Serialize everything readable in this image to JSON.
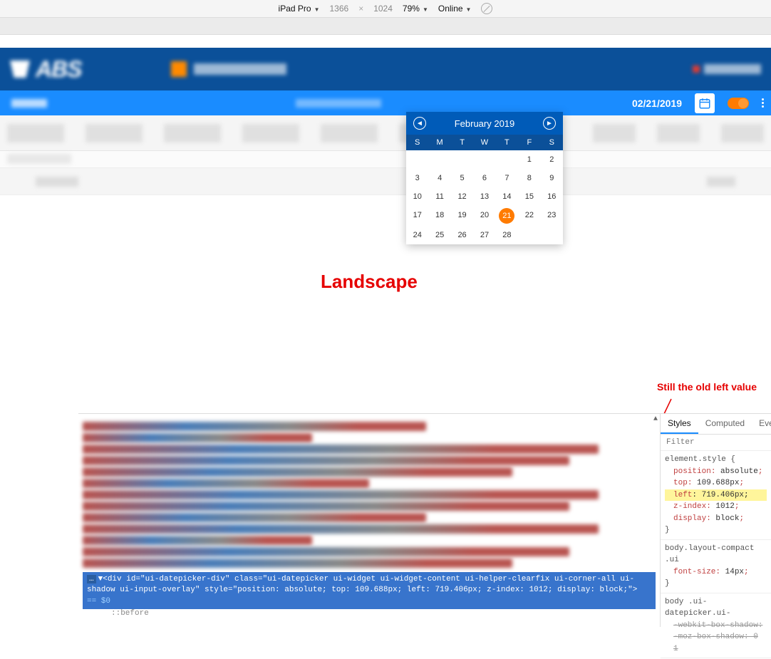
{
  "device_toolbar": {
    "device": "iPad Pro",
    "width": "1366",
    "height": "1024",
    "zoom": "79%",
    "network": "Online"
  },
  "app": {
    "logo_text": "ABS"
  },
  "subheader": {
    "date": "02/21/2019"
  },
  "datepicker": {
    "title": "February 2019",
    "dayheads": [
      "S",
      "M",
      "T",
      "W",
      "T",
      "F",
      "S"
    ],
    "weeks": [
      [
        "",
        "",
        "",
        "",
        "",
        "1",
        "2"
      ],
      [
        "3",
        "4",
        "5",
        "6",
        "7",
        "8",
        "9"
      ],
      [
        "10",
        "11",
        "12",
        "13",
        "14",
        "15",
        "16"
      ],
      [
        "17",
        "18",
        "19",
        "20",
        "21",
        "22",
        "23"
      ],
      [
        "24",
        "25",
        "26",
        "27",
        "28",
        "",
        ""
      ]
    ],
    "selected": "21"
  },
  "labels": {
    "landscape": "Landscape",
    "annotation": "Still the old left value"
  },
  "devtools": {
    "tabs": {
      "styles": "Styles",
      "computed": "Computed",
      "event": "Eve"
    },
    "filter_placeholder": "Filter",
    "selected_html": "<div id=\"ui-datepicker-div\" class=\"ui-datepicker ui-widget ui-widget-content ui-helper-clearfix ui-corner-all ui-shadow ui-input-overlay\" style=\"position: absolute; top: 109.688px; left: 719.406px; z-index: 1012; display: block;\">",
    "eq_suffix": "== $0",
    "before": "::before",
    "css1_sel": "element.style {",
    "css1_p1": "position",
    "css1_v1": "absolute",
    "css1_p2": "top",
    "css1_v2": "109.688px",
    "css1_p3": "left",
    "css1_v3": "719.406px",
    "css1_p4": "z-index",
    "css1_v4": "1012",
    "css1_p5": "display",
    "css1_v5": "block",
    "css_close": "}",
    "css2_sel": "body.layout-compact .ui",
    "css2_p1": "font-size",
    "css2_v1": "14px",
    "css3_sel": "body .ui-datepicker.ui-",
    "css3_s1": "-webkit-box-shadow:",
    "css3_s2": "-moz-box-shadow: 0 1"
  }
}
